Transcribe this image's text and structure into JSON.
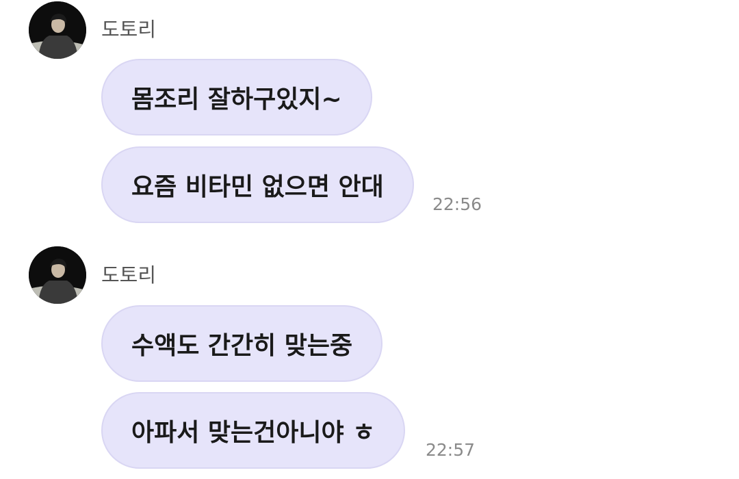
{
  "groups": [
    {
      "sender": "도토리",
      "avatar_icon": "profile-photo-icon",
      "messages": [
        "몸조리 잘하구있지~",
        "요즘 비타민 없으면 안대"
      ],
      "time": "22:56"
    },
    {
      "sender": "도토리",
      "avatar_icon": "profile-photo-icon",
      "messages": [
        "수액도 간간히 맞는중",
        "아파서 맞는건아니야 ㅎ"
      ],
      "time": "22:57"
    }
  ],
  "colors": {
    "bubble": "#e6e4fa",
    "bubble_border": "#d9d6f3",
    "sender_text": "#555555",
    "time_text": "#8a8a8a"
  }
}
